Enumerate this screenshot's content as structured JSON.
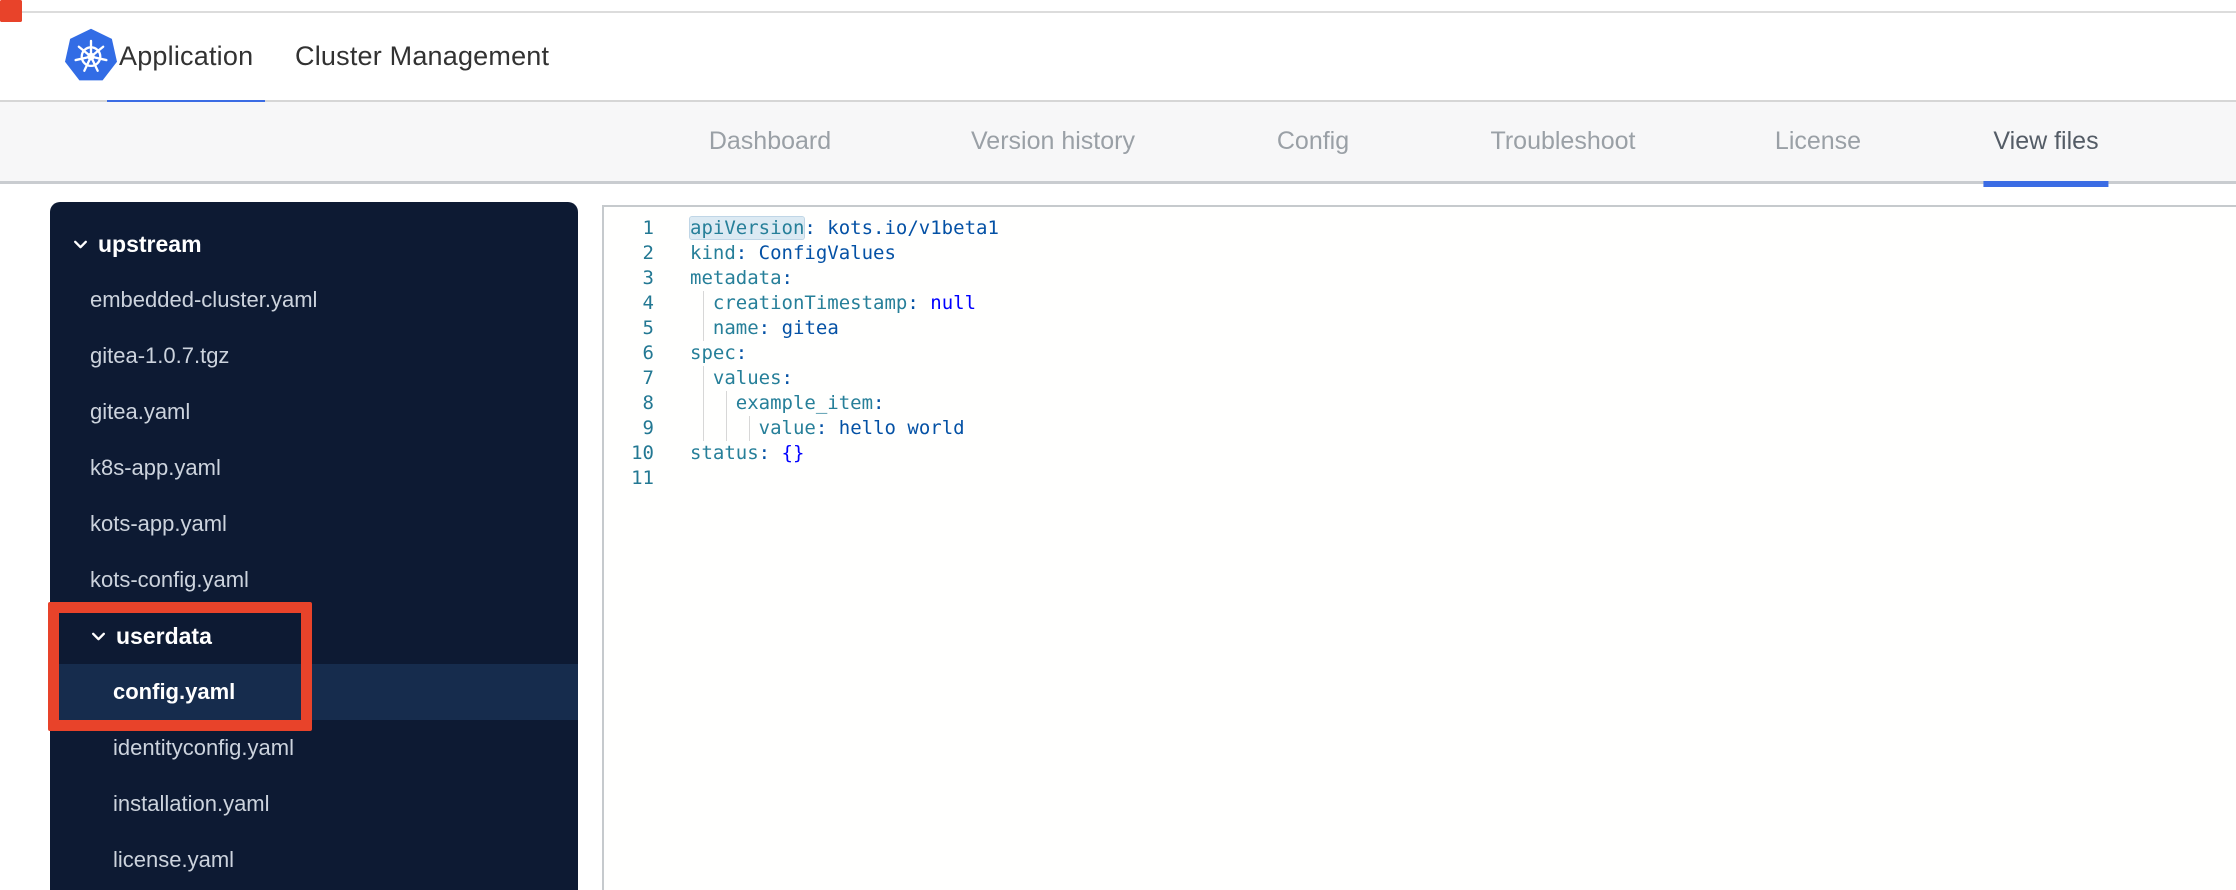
{
  "header": {
    "logo_icon": "kubernetes-logo",
    "tabs": [
      {
        "label": "Application",
        "active": true
      },
      {
        "label": "Cluster Management",
        "active": false
      }
    ]
  },
  "subnav": {
    "tabs": [
      {
        "label": "Dashboard",
        "active": false
      },
      {
        "label": "Version history",
        "active": false
      },
      {
        "label": "Config",
        "active": false
      },
      {
        "label": "Troubleshoot",
        "active": false
      },
      {
        "label": "License",
        "active": false
      },
      {
        "label": "View files",
        "active": true
      }
    ]
  },
  "file_tree": {
    "items": [
      {
        "label": "upstream",
        "type": "folder",
        "level": 0,
        "expanded": true,
        "icon": "chevron-down"
      },
      {
        "label": "embedded-cluster.yaml",
        "type": "file",
        "level": 1
      },
      {
        "label": "gitea-1.0.7.tgz",
        "type": "file",
        "level": 1
      },
      {
        "label": "gitea.yaml",
        "type": "file",
        "level": 1
      },
      {
        "label": "k8s-app.yaml",
        "type": "file",
        "level": 1
      },
      {
        "label": "kots-app.yaml",
        "type": "file",
        "level": 1
      },
      {
        "label": "kots-config.yaml",
        "type": "file",
        "level": 1
      },
      {
        "label": "userdata",
        "type": "folder",
        "level": 1,
        "expanded": true,
        "icon": "chevron-down"
      },
      {
        "label": "config.yaml",
        "type": "file",
        "level": 2,
        "selected": true
      },
      {
        "label": "identityconfig.yaml",
        "type": "file",
        "level": 2
      },
      {
        "label": "installation.yaml",
        "type": "file",
        "level": 2
      },
      {
        "label": "license.yaml",
        "type": "file",
        "level": 2
      }
    ]
  },
  "editor": {
    "language": "yaml",
    "lines": [
      {
        "n": "1",
        "guides": 0,
        "tokens": [
          {
            "c": "tok-key tok-hl",
            "t": "apiVersion"
          },
          {
            "c": "tok-pun",
            "t": ":"
          },
          {
            "c": "",
            "t": " "
          },
          {
            "c": "tok-val",
            "t": "kots.io/v1beta1"
          }
        ]
      },
      {
        "n": "2",
        "guides": 0,
        "tokens": [
          {
            "c": "tok-key",
            "t": "kind"
          },
          {
            "c": "tok-pun",
            "t": ":"
          },
          {
            "c": "",
            "t": " "
          },
          {
            "c": "tok-val",
            "t": "ConfigValues"
          }
        ]
      },
      {
        "n": "3",
        "guides": 0,
        "tokens": [
          {
            "c": "tok-key",
            "t": "metadata"
          },
          {
            "c": "tok-pun",
            "t": ":"
          }
        ]
      },
      {
        "n": "4",
        "guides": 1,
        "tokens": [
          {
            "c": "",
            "t": "  "
          },
          {
            "c": "tok-key",
            "t": "creationTimestamp"
          },
          {
            "c": "tok-pun",
            "t": ":"
          },
          {
            "c": "",
            "t": " "
          },
          {
            "c": "tok-kw",
            "t": "null"
          }
        ]
      },
      {
        "n": "5",
        "guides": 1,
        "tokens": [
          {
            "c": "",
            "t": "  "
          },
          {
            "c": "tok-key",
            "t": "name"
          },
          {
            "c": "tok-pun",
            "t": ":"
          },
          {
            "c": "",
            "t": " "
          },
          {
            "c": "tok-val",
            "t": "gitea"
          }
        ]
      },
      {
        "n": "6",
        "guides": 0,
        "tokens": [
          {
            "c": "tok-key",
            "t": "spec"
          },
          {
            "c": "tok-pun",
            "t": ":"
          }
        ]
      },
      {
        "n": "7",
        "guides": 1,
        "tokens": [
          {
            "c": "",
            "t": "  "
          },
          {
            "c": "tok-key",
            "t": "values"
          },
          {
            "c": "tok-pun",
            "t": ":"
          }
        ]
      },
      {
        "n": "8",
        "guides": 2,
        "tokens": [
          {
            "c": "",
            "t": "    "
          },
          {
            "c": "tok-key",
            "t": "example_item"
          },
          {
            "c": "tok-pun",
            "t": ":"
          }
        ]
      },
      {
        "n": "9",
        "guides": 3,
        "tokens": [
          {
            "c": "",
            "t": "      "
          },
          {
            "c": "tok-key",
            "t": "value"
          },
          {
            "c": "tok-pun",
            "t": ":"
          },
          {
            "c": "",
            "t": " "
          },
          {
            "c": "tok-val",
            "t": "hello world"
          }
        ]
      },
      {
        "n": "10",
        "guides": 0,
        "tokens": [
          {
            "c": "tok-key",
            "t": "status"
          },
          {
            "c": "tok-pun",
            "t": ":"
          },
          {
            "c": "",
            "t": " "
          },
          {
            "c": "tok-kw",
            "t": "{}"
          }
        ]
      },
      {
        "n": "11",
        "guides": 0,
        "tokens": []
      }
    ]
  },
  "annotations": {
    "color": "#e8432a",
    "boxes": [
      {
        "target": "view-files-tab"
      },
      {
        "target": "upstream-folder"
      },
      {
        "target": "userdata-config"
      }
    ]
  },
  "colors": {
    "accent_blue": "#3b6ce4",
    "logo_blue": "#326ce5",
    "annotation_red": "#e8432a",
    "sidebar_bg": "#0d1a33",
    "sidebar_selected_bg": "#162c4d",
    "yaml_key": "#267f99",
    "yaml_value": "#0451a5",
    "yaml_keyword": "#0000ff",
    "line_number": "#237893"
  }
}
